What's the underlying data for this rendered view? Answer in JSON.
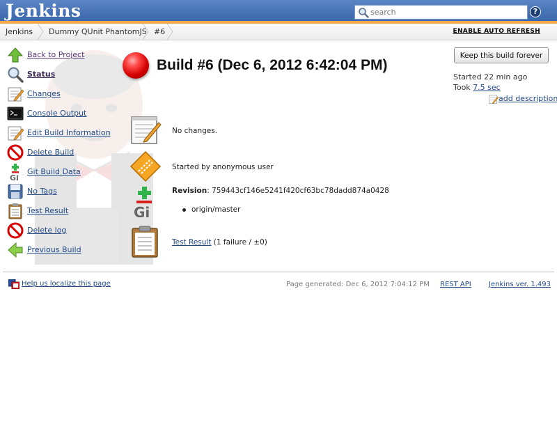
{
  "header": {
    "logo": "Jenkins",
    "search_placeholder": "search",
    "help_icon": "question-icon"
  },
  "breadcrumb": [
    "Jenkins",
    "Dummy QUnit PhantomJS",
    "#6"
  ],
  "auto_refresh": "ENABLE AUTO REFRESH",
  "tasks": [
    {
      "label": "Back to Project",
      "icon": "up-arrow-icon"
    },
    {
      "label": "Status",
      "icon": "magnifier-icon",
      "current": true
    },
    {
      "label": "Changes",
      "icon": "notepad-icon"
    },
    {
      "label": "Console Output",
      "icon": "terminal-icon"
    },
    {
      "label": "Edit Build Information",
      "icon": "notepad-icon"
    },
    {
      "label": "Delete Build",
      "icon": "no-entry-icon"
    },
    {
      "label": "Git Build Data",
      "icon": "git-icon"
    },
    {
      "label": "No Tags",
      "icon": "save-icon"
    },
    {
      "label": "Test Result",
      "icon": "clipboard-icon"
    },
    {
      "label": "Delete log",
      "icon": "no-entry-icon"
    },
    {
      "label": "Previous Build",
      "icon": "left-arrow-icon"
    }
  ],
  "build": {
    "title": "Build #6 (Dec 6, 2012 6:42:04 PM)",
    "status_color": "#e00000",
    "keep_forever": "Keep this build forever",
    "started": "Started 22 min ago",
    "took_prefix": "Took ",
    "took_link": "7.5 sec",
    "add_description": "add description"
  },
  "summary": {
    "changes": "No changes.",
    "cause": "Started by anonymous user",
    "revision_label": "Revision",
    "revision_value": ": 759443cf146e5241f420cf63bc78dadd874a0428",
    "branch": "origin/master",
    "test_result_link": "Test Result",
    "test_result_detail": " (1 failure / ±0)"
  },
  "footer": {
    "localize": "Help us localize this page",
    "page_generated": "Page generated: Dec 6, 2012 7:04:12 PM",
    "rest_api": "REST API",
    "jenkins_version": "Jenkins ver. 1.493"
  }
}
